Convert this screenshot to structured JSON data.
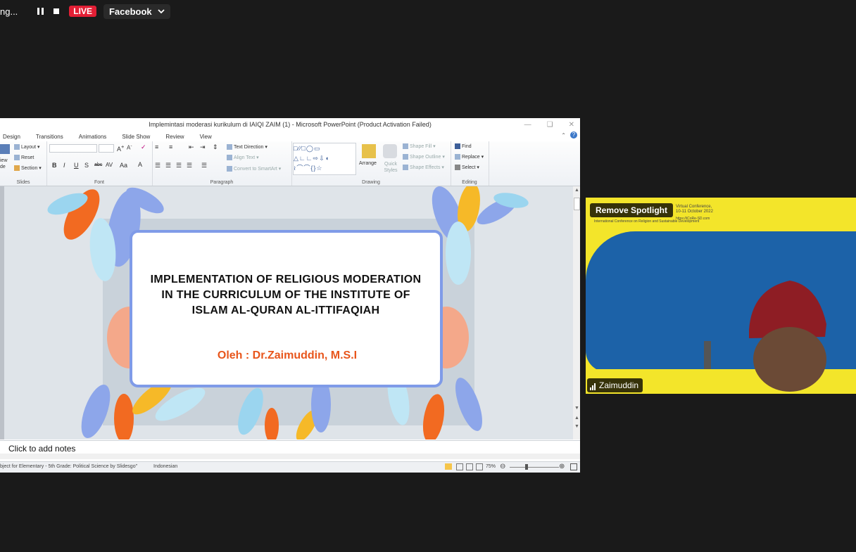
{
  "topbar": {
    "recording_text": "ng...",
    "live_label": "LIVE",
    "stream_target": "Facebook"
  },
  "ppt": {
    "window_title": "Implemintasi moderasi kurikulum di IAIQI ZAIM  (1)  -  Microsoft PowerPoint (Product Activation Failed)",
    "tabs": [
      "Design",
      "Transitions",
      "Animations",
      "Slide Show",
      "Review",
      "View"
    ],
    "ribbon": {
      "slides": {
        "label": "Slides",
        "layout": "Layout",
        "reset": "Reset",
        "section": "Section",
        "new_slide_1": "iew",
        "new_slide_2": "de"
      },
      "font": {
        "label": "Font"
      },
      "paragraph": {
        "label": "Paragraph",
        "text_direction": "Text Direction",
        "align_text": "Align Text",
        "convert_smartart": "Convert to SmartArt"
      },
      "drawing": {
        "label": "Drawing",
        "arrange": "Arrange",
        "quick_styles": "Quick Styles",
        "shape_fill": "Shape Fill",
        "shape_outline": "Shape Outline",
        "shape_effects": "Shape Effects"
      },
      "editing": {
        "label": "Editing",
        "find": "Find",
        "replace": "Replace",
        "select": "Select"
      }
    },
    "slide": {
      "title": "IMPLEMENTATION OF RELIGIOUS MODERATION IN THE CURRICULUM OF THE INSTITUTE OF ISLAM AL-QURAN AL-ITTIFAQIAH",
      "author": "Oleh : Dr.Zaimuddin, M.S.I"
    },
    "notes_placeholder": "Click to add notes",
    "status": {
      "theme": "bject for Elementary - 5th Grade: Political Science by Slidesgo\"",
      "language": "Indonesian",
      "zoom": "75%"
    }
  },
  "video": {
    "remove_spotlight": "Remove Spotlight",
    "participant_name": "Zaimuddin",
    "banner_1": "Virtual Conference,",
    "banner_2": "10-11 October 2022",
    "banner_3": "International Conference on Religion and Sustainable Development",
    "banner_4": "https://iCoRe-SD.com"
  },
  "colors": {
    "live": "#e21f35",
    "author": "#e8561c",
    "frame": "#7f9be8",
    "video_bg": "#f3e52a"
  }
}
